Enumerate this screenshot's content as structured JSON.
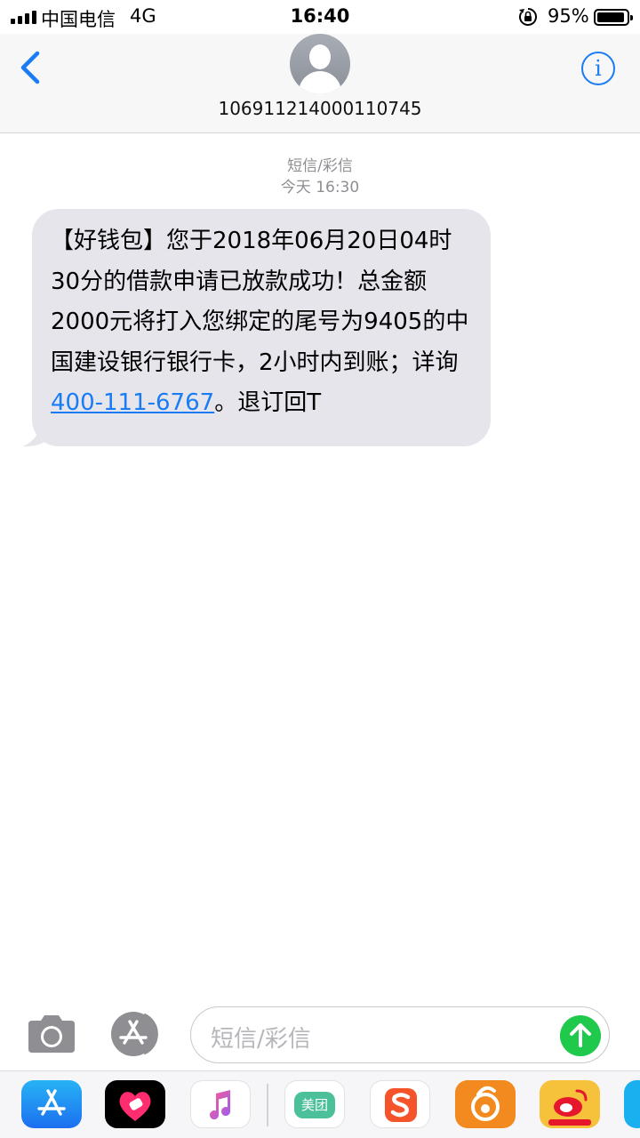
{
  "status_bar": {
    "carrier": "中国电信",
    "network": "4G",
    "time": "16:40",
    "battery_percent": "95%",
    "battery_level": 0.95
  },
  "header": {
    "contact": "106911214000110745",
    "back_icon": "chevron-left-icon",
    "info_icon": "info-icon",
    "info_symbol": "i"
  },
  "conversation": {
    "message_type": "短信/彩信",
    "timestamp": "今天 16:30",
    "messages": [
      {
        "text_before_link": "【好钱包】您于2018年06月20日04时30分的借款申请已放款成功！总金额2000元将打入您绑定的尾号为9405的中国建设银行银行卡，2小时内到账；详询",
        "link": "400-111-6767",
        "text_after_link": "。退订回T"
      }
    ]
  },
  "input_bar": {
    "placeholder": "短信/彩信",
    "camera_icon": "camera-icon",
    "appstore_icon": "app-store-icon",
    "send_icon": "arrow-up-icon"
  },
  "app_drawer": {
    "apps": [
      {
        "icon": "app-store-icon"
      },
      {
        "icon": "heart-sticker-icon"
      },
      {
        "icon": "music-note-icon"
      },
      {
        "icon": "meituan-icon",
        "label": "美团"
      },
      {
        "icon": "sogou-icon"
      },
      {
        "icon": "uc-browser-icon"
      },
      {
        "icon": "weibo-icon"
      },
      {
        "icon": "partial-app-icon"
      }
    ],
    "colors": {
      "accent": "#1a7cf5",
      "send": "#1ec94b",
      "bubble": "#e6e5eb"
    }
  }
}
